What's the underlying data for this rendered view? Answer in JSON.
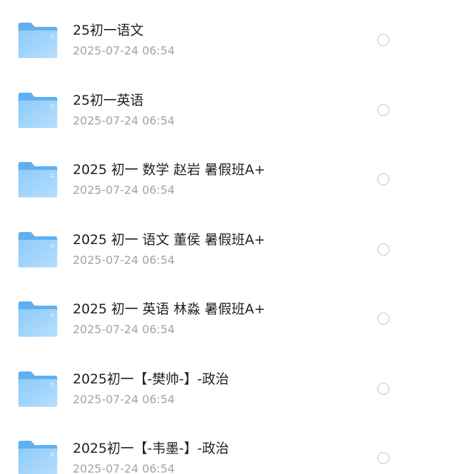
{
  "files": [
    {
      "name": "25初一语文",
      "time": "2025-07-24 06:54",
      "icon": "folder-icon"
    },
    {
      "name": "25初一英语",
      "time": "2025-07-24 06:54",
      "icon": "folder-icon"
    },
    {
      "name": "2025 初一 数学 赵岩 暑假班A+",
      "time": "2025-07-24 06:54",
      "icon": "folder-icon"
    },
    {
      "name": "2025 初一 语文 董侯 暑假班A+",
      "time": "2025-07-24 06:54",
      "icon": "folder-icon"
    },
    {
      "name": "2025 初一 英语 林淼 暑假班A+",
      "time": "2025-07-24 06:54",
      "icon": "folder-icon"
    },
    {
      "name": "2025初一【-樊帅-】-政治",
      "time": "2025-07-24 06:54",
      "icon": "folder-icon"
    },
    {
      "name": "2025初一【-韦墨-】-政治",
      "time": "2025-07-24 06:54",
      "icon": "folder-icon"
    }
  ],
  "colors": {
    "folder_light": "#9fd2fb",
    "folder_dark": "#62b1f2",
    "name_text": "#1f1f1f",
    "time_text": "#a3a3a3",
    "radio_border": "#c4c4c4"
  }
}
